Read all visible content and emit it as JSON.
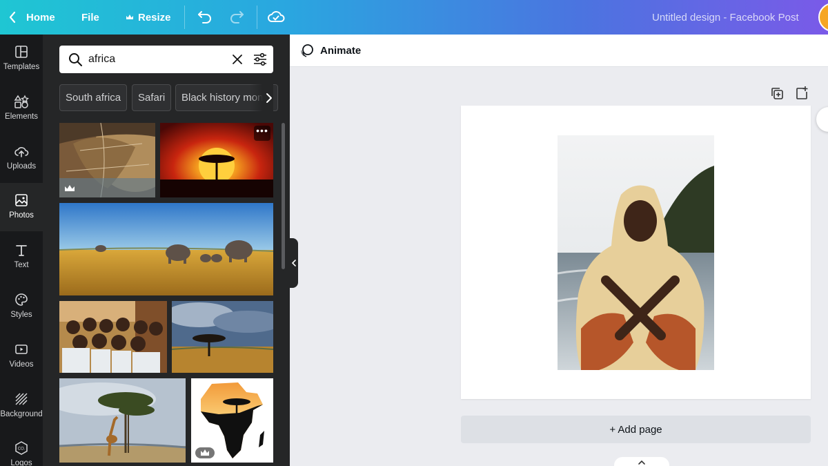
{
  "topbar": {
    "home_label": "Home",
    "file_label": "File",
    "resize_label": "Resize",
    "title": "Untitled design - Facebook Post",
    "icons": [
      "chevron-left-icon",
      "crown-icon",
      "undo-icon",
      "redo-icon",
      "cloud-check-icon"
    ]
  },
  "rail": {
    "items": [
      {
        "label": "Templates",
        "icon": "templates-icon"
      },
      {
        "label": "Elements",
        "icon": "elements-icon"
      },
      {
        "label": "Uploads",
        "icon": "upload-cloud-icon"
      },
      {
        "label": "Photos",
        "icon": "photo-icon",
        "active": true
      },
      {
        "label": "Text",
        "icon": "text-icon"
      },
      {
        "label": "Styles",
        "icon": "palette-icon"
      },
      {
        "label": "Videos",
        "icon": "video-icon"
      },
      {
        "label": "Background",
        "icon": "background-icon"
      },
      {
        "label": "Logos",
        "icon": "logo-icon"
      }
    ]
  },
  "search": {
    "value": "africa",
    "placeholder": ""
  },
  "chips": [
    "South africa",
    "Safari",
    "Black history month"
  ],
  "editor": {
    "animate_label": "Animate",
    "add_page_label": "+ Add page"
  },
  "colors": {
    "accent_start": "#1fc6d3",
    "accent_end": "#7a5ae8",
    "panel_bg": "#252627",
    "rail_bg": "#18191b",
    "canvas_bg": "#ebecf0"
  }
}
